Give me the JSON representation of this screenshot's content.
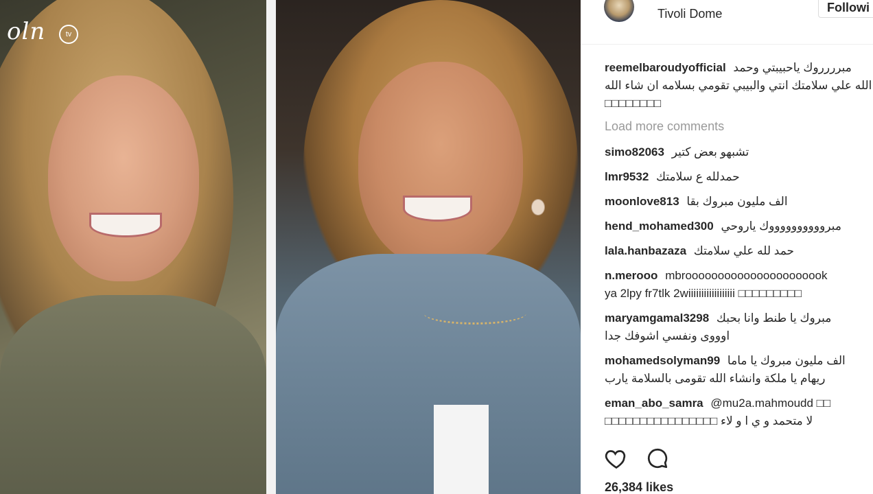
{
  "video": {
    "logo_text": "oln",
    "logo_badge": "tv"
  },
  "post": {
    "location": "Tivoli Dome",
    "follow_label": "Followi",
    "load_more_label": "Load more comments",
    "likes_label": "26,384 likes",
    "comments": [
      {
        "user": "reemelbaroudyofficial",
        "text": "مبرررروك ياحبيبتي وحمد",
        "line2": "الله علي سلامتك انتي والبيبي تقومي بسلامه ان شاء الله",
        "line3": "□□□□□□□□"
      },
      {
        "user": "simo82063",
        "text": "تشبهو بعض كتير"
      },
      {
        "user": "lmr9532",
        "text": "حمدلله ع سلامتك"
      },
      {
        "user": "moonlove813",
        "text": "الف مليون مبروك بقا"
      },
      {
        "user": "hend_mohamed300",
        "text": "مبرووووووووووك ياروحي"
      },
      {
        "user": "lala.hanbazaza",
        "text": "حمد لله علي سلامتك"
      },
      {
        "user": "n.merooo",
        "text": "mbroooooooooooooooooooook",
        "line2": "ya 2lpy fr7tlk 2wiiiiiiiiiiiiiiiiii □□□□□□□□□"
      },
      {
        "user": "maryamgamal3298",
        "text": "مبروك يا طنط وانا بحبك",
        "line2": "اوووى ونفسي اشوفك جدا"
      },
      {
        "user": "mohamedsolyman99",
        "text": "الف مليون مبروك يا ماما",
        "line2": "ريهام يا ملكة وانشاء الله تقومى بالسلامة يارب"
      },
      {
        "user": "eman_abo_samra",
        "text": "@mu2a.mahmoudd □□",
        "line2": "□□□□□□□□□□□□□□□□ لا متحمد و ي ا و لاء"
      }
    ]
  },
  "icons": {
    "like": "heart-icon",
    "comment": "comment-bubble-icon"
  },
  "colors": {
    "text": "#262626",
    "muted": "#999999",
    "border": "#dbdbdb"
  }
}
